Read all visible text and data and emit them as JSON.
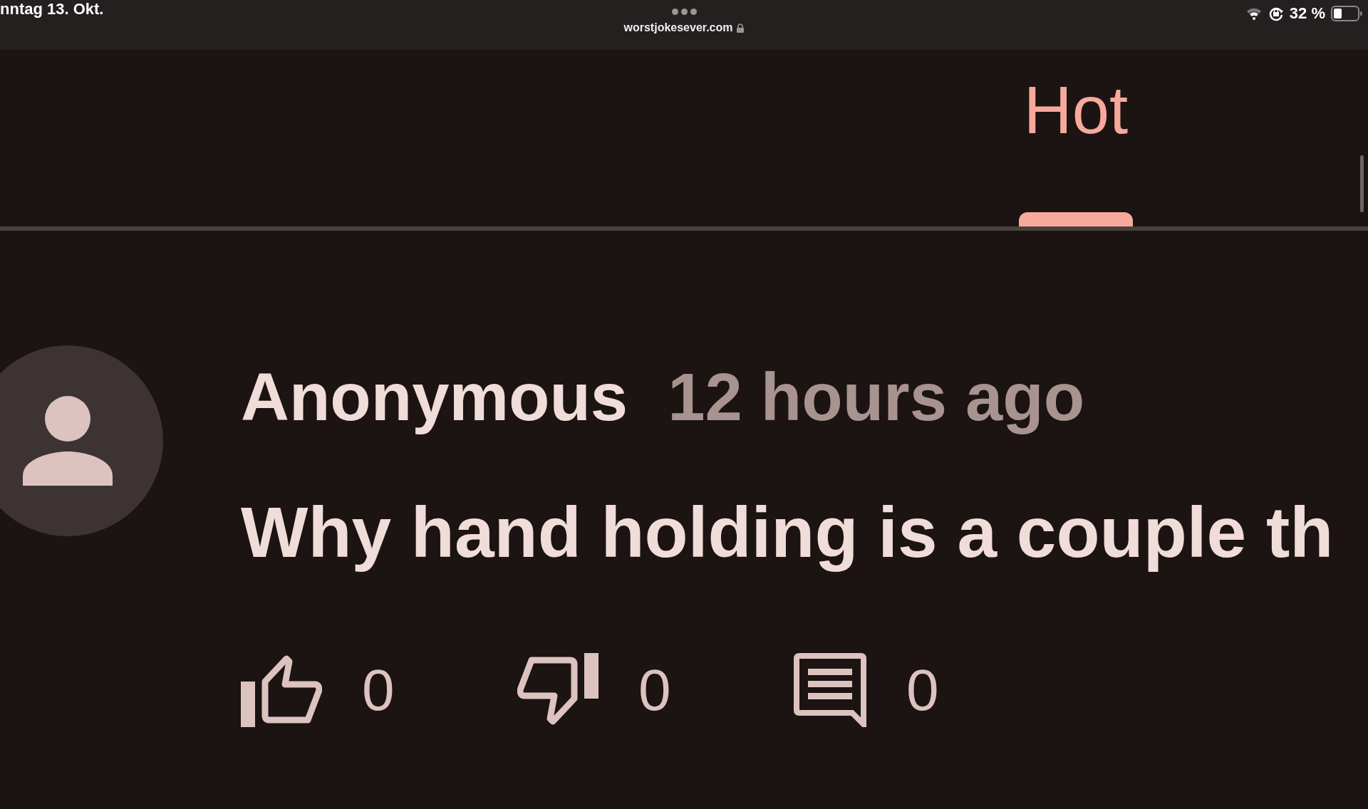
{
  "status_bar": {
    "date": "nntag 13. Okt.",
    "url": "worstjokesever.com",
    "battery": "32 %"
  },
  "tabs": [
    {
      "label": "Hot",
      "selected": true
    }
  ],
  "post": {
    "author": "Anonymous",
    "time": "12 hours ago",
    "text": "Why hand holding is a couple th",
    "actions": [
      {
        "kind": "like",
        "count": "0"
      },
      {
        "kind": "dislike",
        "count": "0"
      },
      {
        "kind": "comment",
        "count": "0"
      }
    ]
  }
}
